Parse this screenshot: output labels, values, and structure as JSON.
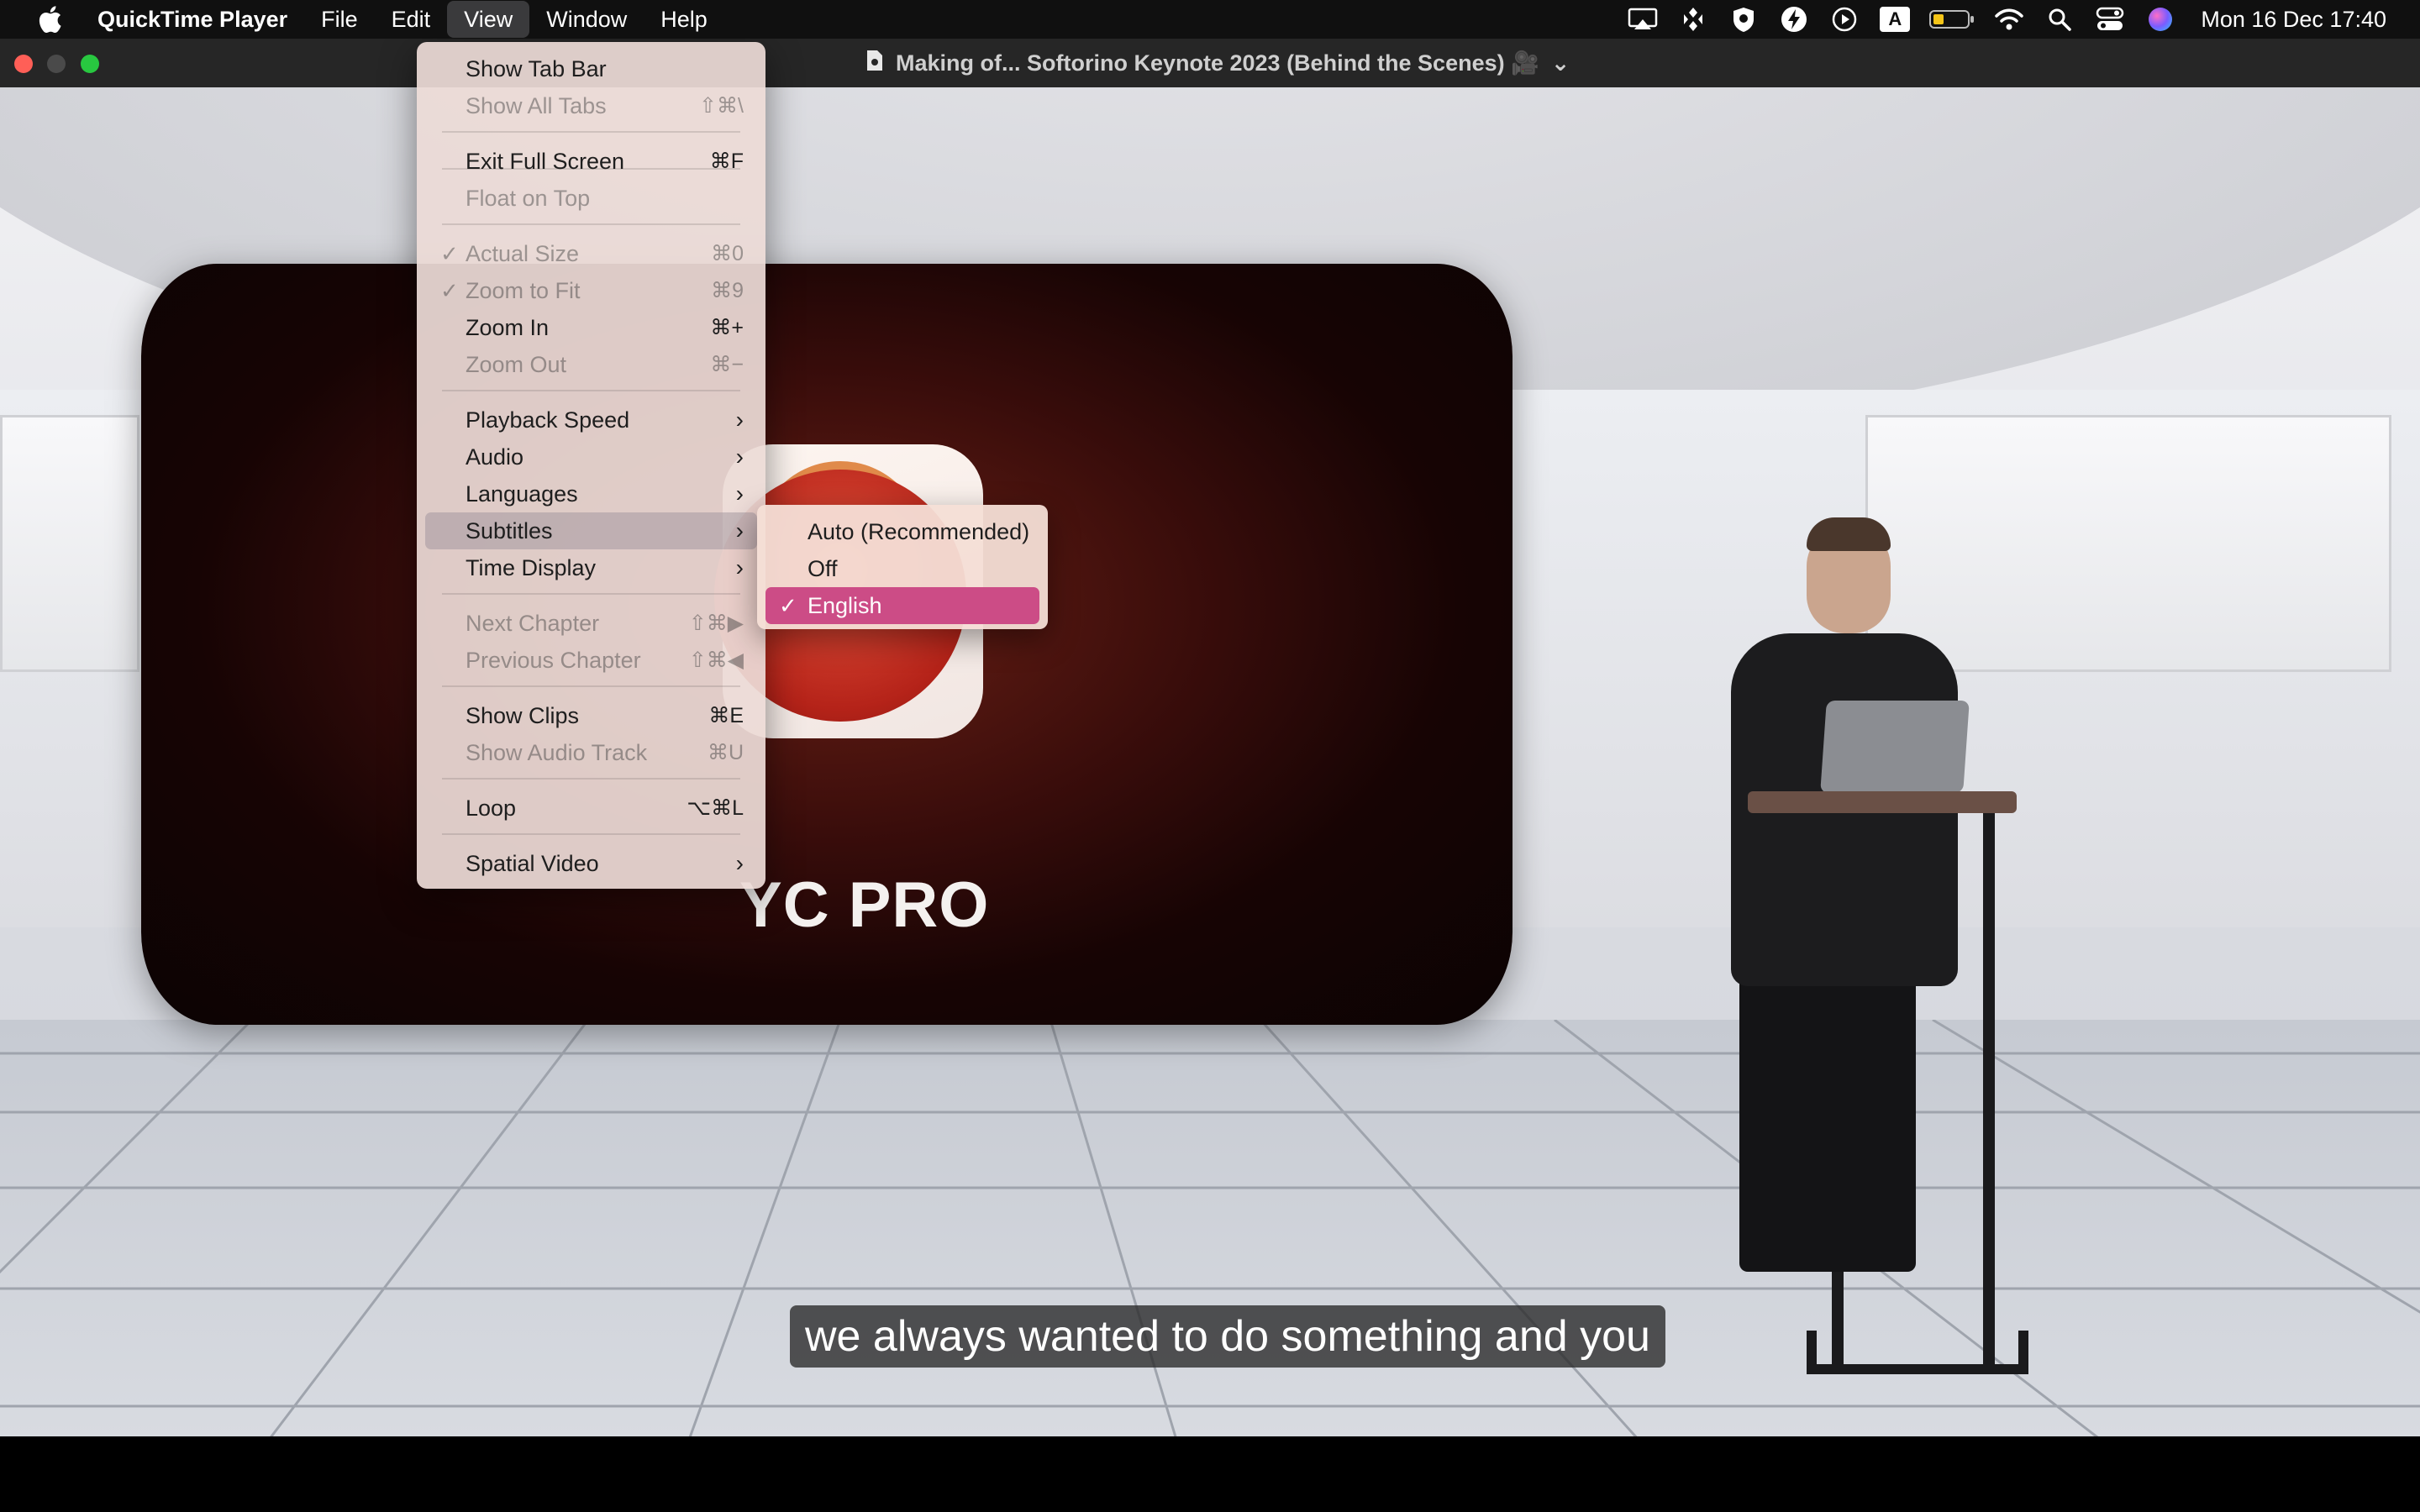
{
  "menubar": {
    "app_name": "QuickTime Player",
    "menus": [
      "File",
      "Edit",
      "View",
      "Window",
      "Help"
    ],
    "active_menu": "View",
    "status_icons": [
      "cast-icon",
      "script-editor-icon",
      "shield-icon",
      "bolt-icon",
      "play-circle-icon",
      "input-source-icon",
      "battery-icon",
      "wifi-icon",
      "search-icon",
      "control-center-icon",
      "siri-icon"
    ],
    "input_source_label": "A",
    "clock": "Mon 16 Dec  17:40"
  },
  "window": {
    "title": "Making of... Softorino Keynote 2023 (Behind the Scenes) 🎥",
    "title_chevron": "⌄"
  },
  "view_menu": {
    "items": [
      {
        "label": "Show Tab Bar",
        "shortcut": "",
        "enabled": true,
        "checked": false,
        "submenu": false
      },
      {
        "label": "Show All Tabs",
        "shortcut": "⇧⌘\\",
        "enabled": false,
        "checked": false,
        "submenu": false
      },
      {
        "label": "Exit Full Screen",
        "shortcut": "⌘F",
        "enabled": true,
        "checked": false,
        "submenu": false
      },
      {
        "label": "Float on Top",
        "shortcut": "",
        "enabled": false,
        "checked": false,
        "submenu": false
      },
      {
        "label": "Actual Size",
        "shortcut": "⌘0",
        "enabled": false,
        "checked": true,
        "submenu": false
      },
      {
        "label": "Zoom to Fit",
        "shortcut": "⌘9",
        "enabled": false,
        "checked": true,
        "submenu": false
      },
      {
        "label": "Zoom In",
        "shortcut": "⌘+",
        "enabled": true,
        "checked": false,
        "submenu": false
      },
      {
        "label": "Zoom Out",
        "shortcut": "⌘−",
        "enabled": false,
        "checked": false,
        "submenu": false
      },
      {
        "label": "Playback Speed",
        "shortcut": "",
        "enabled": true,
        "checked": false,
        "submenu": true
      },
      {
        "label": "Audio",
        "shortcut": "",
        "enabled": true,
        "checked": false,
        "submenu": true
      },
      {
        "label": "Languages",
        "shortcut": "",
        "enabled": true,
        "checked": false,
        "submenu": true
      },
      {
        "label": "Subtitles",
        "shortcut": "",
        "enabled": true,
        "checked": false,
        "submenu": true
      },
      {
        "label": "Time Display",
        "shortcut": "",
        "enabled": true,
        "checked": false,
        "submenu": true
      },
      {
        "label": "Next Chapter",
        "shortcut": "⇧⌘▶",
        "enabled": false,
        "checked": false,
        "submenu": false
      },
      {
        "label": "Previous Chapter",
        "shortcut": "⇧⌘◀",
        "enabled": false,
        "checked": false,
        "submenu": false
      },
      {
        "label": "Show Clips",
        "shortcut": "⌘E",
        "enabled": true,
        "checked": false,
        "submenu": false
      },
      {
        "label": "Show Audio Track",
        "shortcut": "⌘U",
        "enabled": false,
        "checked": false,
        "submenu": false
      },
      {
        "label": "Loop",
        "shortcut": "⌥⌘L",
        "enabled": true,
        "checked": false,
        "submenu": false
      },
      {
        "label": "Spatial Video",
        "shortcut": "",
        "enabled": true,
        "checked": false,
        "submenu": true
      }
    ],
    "highlighted": "Subtitles"
  },
  "subtitles_menu": {
    "items": [
      {
        "label": "Auto (Recommended)",
        "checked": false
      },
      {
        "label": "Off",
        "checked": false
      },
      {
        "label": "English",
        "checked": true
      }
    ],
    "selected": "English"
  },
  "video": {
    "brand_text": "YC PRO",
    "subtitle_text": "we always wanted to do something and you"
  },
  "check_glyph": "✓",
  "chevron_glyph": "›"
}
